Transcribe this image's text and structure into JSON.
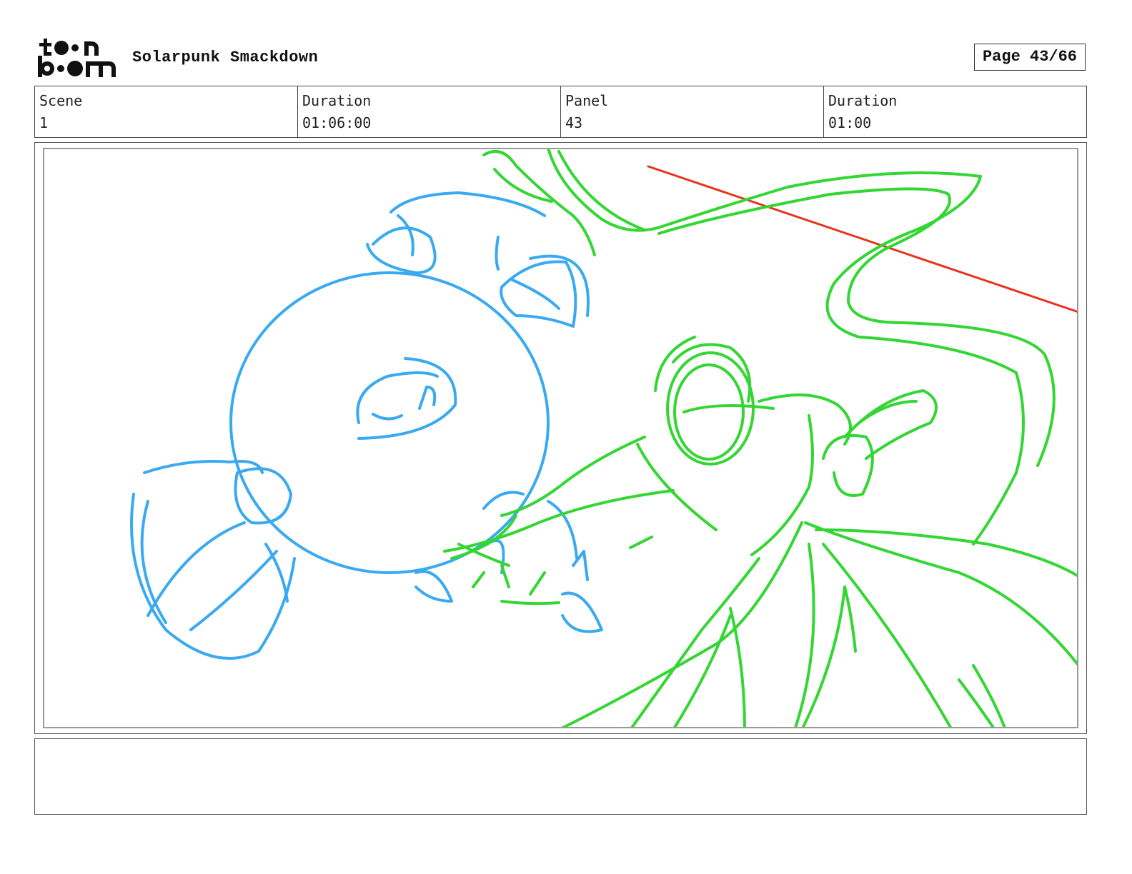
{
  "header": {
    "logo_text_top": "toon",
    "logo_text_bottom": "boom",
    "project_title": "Solarpunk Smackdown",
    "page_label": "Page 43/66"
  },
  "info": {
    "scene_label": "Scene",
    "scene_value": "1",
    "scene_duration_label": "Duration",
    "scene_duration_value": "01:06:00",
    "panel_label": "Panel",
    "panel_value": "43",
    "panel_duration_label": "Duration",
    "panel_duration_value": "01:00"
  },
  "panel": {
    "sketch_colors": {
      "character_a": "#3aaaf0",
      "character_b": "#33d633",
      "action_line": "#e8341c"
    }
  },
  "notes": {
    "text": ""
  }
}
